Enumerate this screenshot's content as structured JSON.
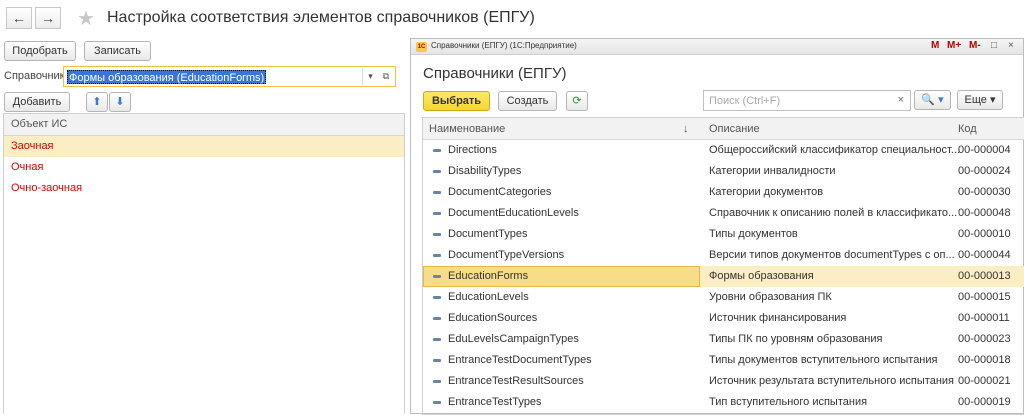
{
  "header": {
    "title": "Настройка соответствия элементов справочников (ЕПГУ)",
    "back": "←",
    "forward": "→",
    "star": "★"
  },
  "toolbar": {
    "select_label": "Подобрать",
    "save_label": "Записать",
    "add_label": "Добавить",
    "up": "⬆",
    "down": "⬇"
  },
  "field": {
    "label": "Справочник:",
    "value": "Формы образования  (EducationForms)",
    "dropdown": "▾",
    "open": "⧉"
  },
  "left_table": {
    "header": "Объект ИС",
    "rows": [
      "Заочная",
      "Очная",
      "Очно-заочная"
    ]
  },
  "window": {
    "title": "Справочники (ЕПГУ)  (1С:Предприятие)",
    "icon": "1С",
    "controls": [
      "M",
      "M+",
      "M-",
      "□",
      "×"
    ],
    "heading": "Справочники (ЕПГУ)",
    "select_btn": "Выбрать",
    "create_btn": "Создать",
    "search_placeholder": "Поиск (Ctrl+F)",
    "search_clear": "×",
    "search_btn": "🔍 ▾",
    "more_btn": "Еще ▾",
    "columns": [
      "Наименование",
      "↓",
      "Описание",
      "Код"
    ],
    "rows": [
      {
        "name": "Directions",
        "desc": "Общероссийский классификатор специальност...",
        "code": "00-000004"
      },
      {
        "name": "DisabilityTypes",
        "desc": "Категории инвалидности",
        "code": "00-000024"
      },
      {
        "name": "DocumentCategories",
        "desc": "Категории документов",
        "code": "00-000030"
      },
      {
        "name": "DocumentEducationLevels",
        "desc": "Справочник к описанию полей в классификато...",
        "code": "00-000048"
      },
      {
        "name": "DocumentTypes",
        "desc": "Типы документов",
        "code": "00-000010"
      },
      {
        "name": "DocumentTypeVersions",
        "desc": "Версии типов документов documentTypes с оп...",
        "code": "00-000044"
      },
      {
        "name": "EducationForms",
        "desc": "Формы образования",
        "code": "00-000013"
      },
      {
        "name": "EducationLevels",
        "desc": "Уровни образования ПК",
        "code": "00-000015"
      },
      {
        "name": "EducationSources",
        "desc": "Источник финансирования",
        "code": "00-000011"
      },
      {
        "name": "EduLevelsCampaignTypes",
        "desc": "Типы ПК по уровням образования",
        "code": "00-000023"
      },
      {
        "name": "EntranceTestDocumentTypes",
        "desc": "Типы документов вступительного испытания",
        "code": "00-000018"
      },
      {
        "name": "EntranceTestResultSources",
        "desc": "Источник результата вступительного испытания",
        "code": "00-000021"
      },
      {
        "name": "EntranceTestTypes",
        "desc": "Тип вступительного испытания",
        "code": "00-000019"
      }
    ]
  }
}
